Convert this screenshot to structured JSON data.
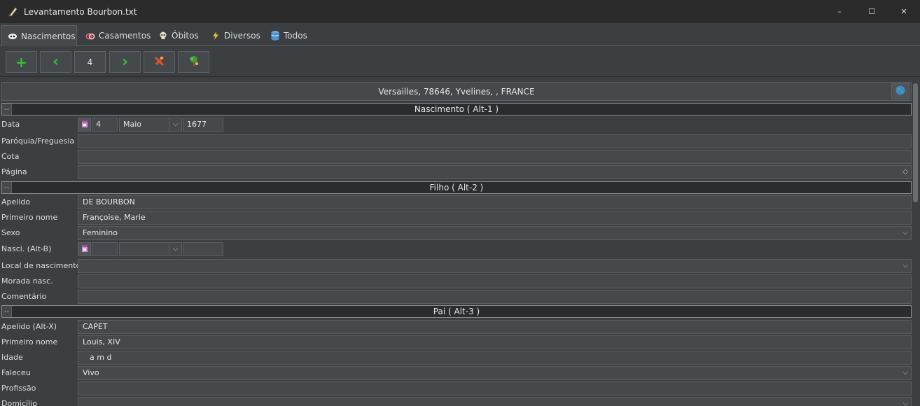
{
  "window": {
    "title": "Levantamento Bourbon.txt",
    "icon": "quill-icon",
    "controls": {
      "minimize": "–",
      "maximize": "☐",
      "close": "✕"
    }
  },
  "tabs": [
    {
      "label": "Nascimentos",
      "icon": "baby-icon",
      "active": true
    },
    {
      "label": "Casamentos",
      "icon": "rings-icon"
    },
    {
      "label": "Óbitos",
      "icon": "skull-icon"
    },
    {
      "label": "Diversos",
      "icon": "lightning-icon"
    },
    {
      "label": "Todos",
      "icon": "database-icon"
    }
  ],
  "toolbar": {
    "add_glyph": "+",
    "prev_glyph": "‹",
    "record_number": "4",
    "next_glyph": "›",
    "delete_icon": "delete-icon",
    "tree_icon": "family-tree-icon"
  },
  "location": "Versailles, 78646, Yvelines, , FRANCE",
  "sections": {
    "nascimento": {
      "toggle": "--",
      "title": "Nascimento   ( Alt-1 )"
    },
    "filho": {
      "toggle": "--",
      "title": "Filho   ( Alt-2 )"
    },
    "pai": {
      "toggle": "--",
      "title": "Pai   ( Alt-3 )"
    }
  },
  "labels": {
    "data": "Data",
    "paroquia": "Paróquia/Freguesia",
    "cota": "Cota",
    "pagina": "Página",
    "apelido": "Apelido",
    "primeiro_nome": "Primeiro nome",
    "sexo": "Sexo",
    "nasci": "Nasci. (Alt-B)",
    "local_nascimento": "Local de nascimento",
    "morada": "Morada nasc.",
    "comentario": "Comentário",
    "pai_apelido": "Apelido (Alt-X)",
    "pai_primeiro_nome": "Primeiro nome",
    "idade": "Idade",
    "faleceu": "Faleceu",
    "profissao": "Profissão",
    "domicilio": "Domicílio"
  },
  "values": {
    "data_day": "4",
    "data_month": "Maio",
    "data_year": "1677",
    "paroquia": "",
    "cota": "",
    "pagina": "",
    "filho_apelido": "DE BOURBON",
    "filho_primeiro_nome": "Françoise, Marie",
    "filho_sexo": "Feminino",
    "nasci_day": "",
    "nasci_month": "",
    "nasci_year": "",
    "local_nascimento": "",
    "morada": "",
    "comentario": "",
    "pai_apelido": "CAPET",
    "pai_primeiro_nome": "Louis, XIV",
    "idade": "a   m   d",
    "faleceu": "Vivo",
    "profissao": "",
    "domicilio": ""
  },
  "colors": {
    "background": "#3b3f42",
    "field": "#45494c",
    "section_header": "#2a2c2e",
    "titlebar": "#2b2b2b",
    "green_button": "#33c133",
    "delete_red": "#e2552a"
  }
}
